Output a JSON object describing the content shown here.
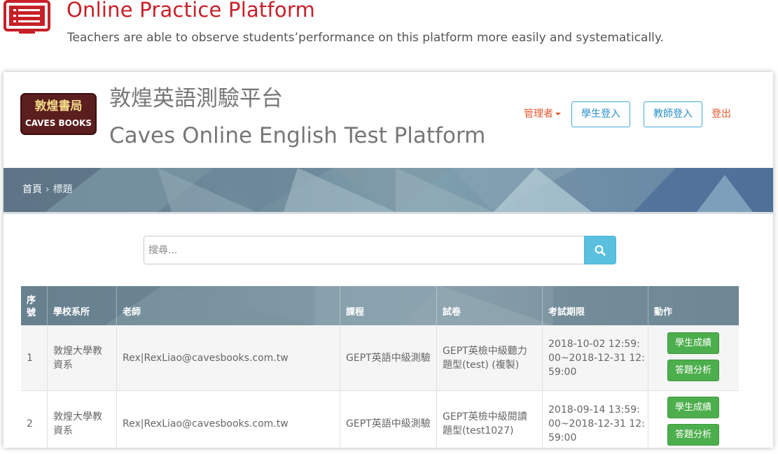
{
  "heading": {
    "title": "Online Practice Platform",
    "subtitle": "Teachers are able to observe students’performance on this platform more easily and systematically.",
    "accent_color": "#c71f27",
    "icon": "list-screen-icon"
  },
  "site": {
    "logo_cn": "敦煌書局",
    "logo_en": "CAVES BOOKS",
    "title_cn": "敦煌英語測驗平台",
    "title_en": "Caves Online English Test Platform"
  },
  "nav": {
    "admin": "管理者",
    "student_login": "學生登入",
    "teacher_login": "教師登入",
    "logout": "登出"
  },
  "breadcrumb": {
    "home": "首頁",
    "separator": "›",
    "current": "標題"
  },
  "search": {
    "placeholder": "搜尋...",
    "button_icon": "search-icon"
  },
  "table": {
    "headers": [
      "序號",
      "學校系所",
      "老師",
      "課程",
      "試卷",
      "考試期限",
      "動作"
    ],
    "rows": [
      {
        "seq": "1",
        "school": "敦煌大學教資系",
        "teacher": "Rex|RexLiao@cavesbooks.com.tw",
        "course": "GEPT英語中級測驗",
        "paper": "GEPT英檢中級聽力題型(test) (複製)",
        "period": "2018-10-02 12:59:00~2018-12-31 12:59:00",
        "action_scores": "學生成績",
        "action_analysis": "答題分析"
      },
      {
        "seq": "2",
        "school": "敦煌大學教資系",
        "teacher": "Rex|RexLiao@cavesbooks.com.tw",
        "course": "GEPT英語中級測驗",
        "paper": "GEPT英檢中級閱讀題型(test1027)",
        "period": "2018-09-14 13:59:00~2018-12-31 12:59:00",
        "action_scores": "學生成績",
        "action_analysis": "答題分析"
      }
    ]
  }
}
